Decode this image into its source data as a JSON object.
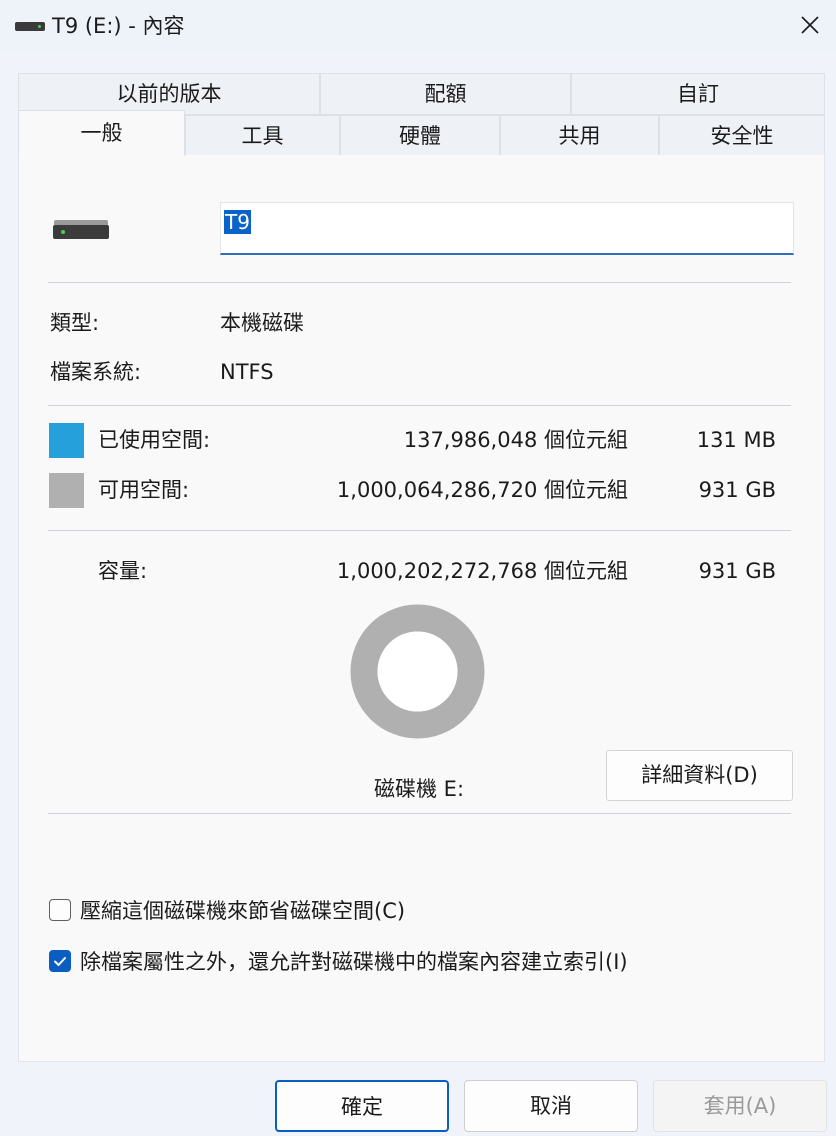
{
  "window": {
    "title": "T9 (E:) - 內容"
  },
  "tabs": {
    "row1": [
      "以前的版本",
      "配額",
      "自訂"
    ],
    "row2": [
      "一般",
      "工具",
      "硬體",
      "共用",
      "安全性"
    ],
    "selected": "一般"
  },
  "general": {
    "name_value": "T9",
    "type_label": "類型:",
    "type_value": "本機磁碟",
    "fs_label": "檔案系統:",
    "fs_value": "NTFS",
    "used": {
      "label": "已使用空間:",
      "bytes": "137,986,048 個位元組",
      "size": "131 MB",
      "color": "#26a0da"
    },
    "free": {
      "label": "可用空間:",
      "bytes": "1,000,064,286,720 個位元組",
      "size": "931 GB",
      "color": "#b0b0b0"
    },
    "capacity": {
      "label": "容量:",
      "bytes": "1,000,202,272,768 個位元組",
      "size": "931 GB"
    },
    "used_fraction": 0.000138,
    "drive_label": "磁碟機 E:",
    "details_button": "詳細資料(D)",
    "compress_label": "壓縮這個磁碟機來節省磁碟空間(C)",
    "compress_checked": false,
    "index_label": "除檔案屬性之外，還允許對磁碟機中的檔案內容建立索引(I)",
    "index_checked": true
  },
  "footer": {
    "ok": "確定",
    "cancel": "取消",
    "apply": "套用(A)"
  },
  "icons": {
    "drive": "drive-icon",
    "close": "close-icon",
    "check": "checkmark-icon"
  },
  "colors": {
    "accent": "#0a5ec2",
    "selection": "#0a64c8"
  }
}
